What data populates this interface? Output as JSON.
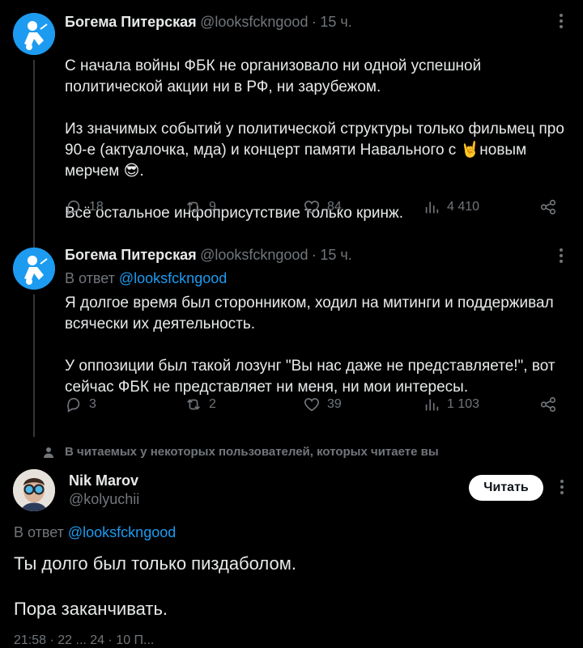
{
  "tweets": [
    {
      "author_name": "Богема Питерская",
      "handle": "@looksfckngood",
      "dot": "·",
      "time": "15 ч.",
      "text_part1": "С начала войны ФБК не организовало ни одной успешной политической акции ни в РФ, ни зарубежом.\n\nИз значимых событий у политической структуры только фильмец про 90-е (актуалочка, мда) и концерт памяти Навального с ",
      "emoji_horns": "🤘",
      "text_part2": "новым мерчем ",
      "emoji_cool": "😎",
      "text_part3": ".\n\nВсё остальное инфоприсутствие только кринж.",
      "replies": "18",
      "retweets": "9",
      "likes": "84",
      "views": "4 410"
    },
    {
      "author_name": "Богема Питерская",
      "handle": "@looksfckngood",
      "dot": "·",
      "time": "15 ч.",
      "reply_prefix": "В ответ ",
      "reply_to": "@looksfckngood",
      "text": "Я долгое время был сторонником, ходил на митинги и поддерживал всячески их деятельность.\n\nУ оппозиции был такой лозунг \"Вы нас даже не представляете!\", вот сейчас ФБК не представляет ни меня, ни мои интересы.",
      "replies": "3",
      "retweets": "2",
      "likes": "39",
      "views": "1 103"
    }
  ],
  "context_label": "В читаемых у некоторых пользователей, которых читаете вы",
  "main_tweet": {
    "author_name": "Nik Marov",
    "handle": "@kolyuchii",
    "follow_label": "Читать",
    "reply_prefix": "В ответ ",
    "reply_to": "@looksfckngood",
    "text": "Ты долго был только пиздаболом.\n\nПора заканчивать.",
    "footer_partial": "21:58 · 22 ... 24 · 10 П..."
  },
  "colors": {
    "background": "#000000",
    "text": "#e7e9ea",
    "muted": "#71767b",
    "accent": "#1d9bf0"
  }
}
